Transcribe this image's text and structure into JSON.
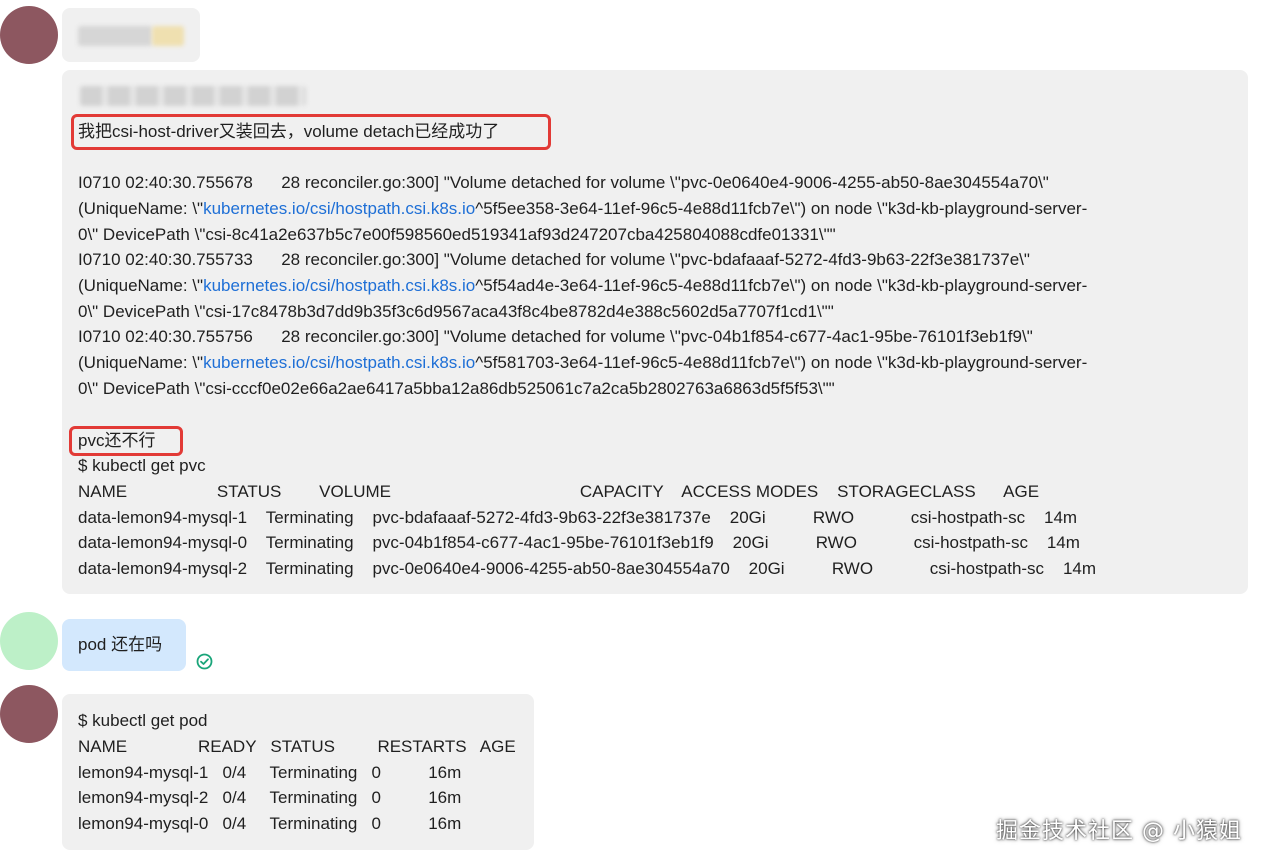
{
  "messages": [
    {
      "sender": "peer",
      "text_lines": [
        "我把csi-host-driver又装回去，volume detach已经成功了",
        "",
        "I0710 02:40:30.755678      28 reconciler.go:300] \"Volume detached for volume \\\"pvc-0e0640e4-9006-4255-ab50-8ae304554a70\\\"",
        "(UniqueName: \\\"",
        "0\\\" DevicePath \\\"csi-8c41a2e637b5c7e00f598560ed519341af93d247207cba425804088cdfe01331\\\"\"",
        "I0710 02:40:30.755733      28 reconciler.go:300] \"Volume detached for volume \\\"pvc-bdafaaaf-5272-4fd3-9b63-22f3e381737e\\\"",
        "(UniqueName: \\\"",
        "0\\\" DevicePath \\\"csi-17c8478b3d7dd9b35f3c6d9567aca43f8c4be8782d4e388c5602d5a7707f1cd1\\\"\"",
        "I0710 02:40:30.755756      28 reconciler.go:300] \"Volume detached for volume \\\"pvc-04b1f854-c677-4ac1-95be-76101f3eb1f9\\\"",
        "(UniqueName: \\\"",
        "0\\\" DevicePath \\\"csi-cccf0e02e66a2ae6417a5bba12a86db525061c7a2ca5b2802763a6863d5f5f53\\\"\"",
        "",
        "pvc还不行",
        "$ kubectl get pvc",
        "NAME                   STATUS        VOLUME                                        CAPACITY    ACCESS MODES    STORAGECLASS      AGE",
        "data-lemon94-mysql-1    Terminating    pvc-bdafaaaf-5272-4fd3-9b63-22f3e381737e    20Gi          RWO            csi-hostpath-sc    14m",
        "data-lemon94-mysql-0    Terminating    pvc-04b1f854-c677-4ac1-95be-76101f3eb1f9    20Gi          RWO            csi-hostpath-sc    14m",
        "data-lemon94-mysql-2    Terminating    pvc-0e0640e4-9006-4255-ab50-8ae304554a70    20Gi          RWO            csi-hostpath-sc    14m"
      ],
      "unique_names": [
        {
          "link": "kubernetes.io/csi/hostpath.csi.k8s.io",
          "rest": "^5f5ee358-3e64-11ef-96c5-4e88d11fcb7e\\\") on node \\\"k3d-kb-playground-server-"
        },
        {
          "link": "kubernetes.io/csi/hostpath.csi.k8s.io",
          "rest": "^5f54ad4e-3e64-11ef-96c5-4e88d11fcb7e\\\") on node \\\"k3d-kb-playground-server-"
        },
        {
          "link": "kubernetes.io/csi/hostpath.csi.k8s.io",
          "rest": "^5f581703-3e64-11ef-96c5-4e88d11fcb7e\\\") on node \\\"k3d-kb-playground-server-"
        }
      ]
    },
    {
      "sender": "me",
      "text": "pod 还在吗",
      "status_icon": "check-circle-icon"
    },
    {
      "sender": "peer",
      "text_lines": [
        "$ kubectl get pod",
        "NAME               READY   STATUS         RESTARTS   AGE",
        "lemon94-mysql-1   0/4     Terminating   0          16m",
        "lemon94-mysql-2   0/4     Terminating   0          16m",
        "lemon94-mysql-0   0/4     Terminating   0          16m"
      ]
    }
  ],
  "watermark": "掘金技术社区 @ 小猿姐",
  "colors": {
    "peer_avatar": "#8d5760",
    "me_avatar": "#bdf0c8",
    "bubble_gray": "#f0f0f0",
    "bubble_blue": "#d3e8fd",
    "highlight": "#e23a36",
    "link": "#1e6fd6",
    "check": "#1aa57a"
  }
}
